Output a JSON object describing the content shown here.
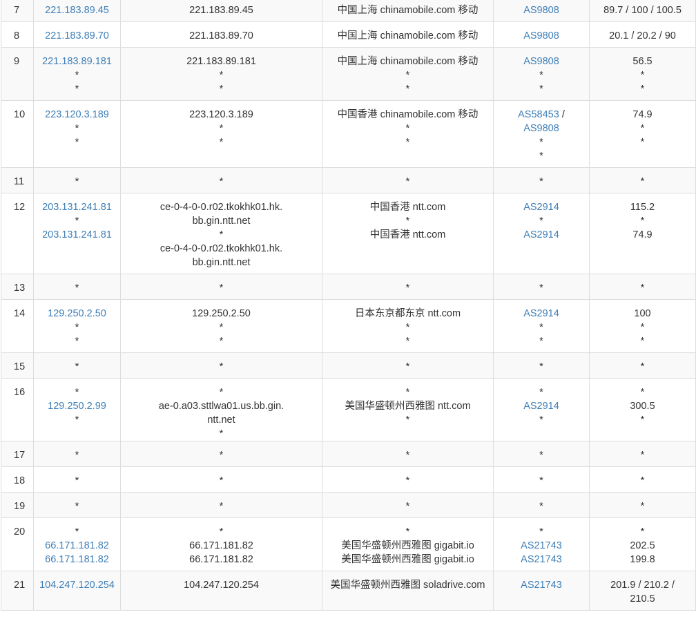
{
  "rows": [
    {
      "hop": "7",
      "h": 37,
      "ips": [
        {
          "t": "221.183.89.45",
          "link": true
        }
      ],
      "hosts": [
        "221.183.89.45"
      ],
      "locs": [
        "中国上海 chinamobile.com 移动"
      ],
      "as_lines": [
        [
          {
            "t": "AS9808",
            "link": true
          }
        ]
      ],
      "lat": [
        "89.7 / 100 / 100.5"
      ]
    },
    {
      "hop": "8",
      "h": 37,
      "ips": [
        {
          "t": "221.183.89.70",
          "link": true
        }
      ],
      "hosts": [
        "221.183.89.70"
      ],
      "locs": [
        "中国上海 chinamobile.com 移动"
      ],
      "as_lines": [
        [
          {
            "t": "AS9808",
            "link": true
          }
        ]
      ],
      "lat": [
        "20.1 / 20.2 / 90"
      ]
    },
    {
      "hop": "9",
      "h": 77,
      "ips": [
        {
          "t": "221.183.89.181",
          "link": true
        },
        {
          "t": "*"
        },
        {
          "t": "*"
        }
      ],
      "hosts": [
        "221.183.89.181",
        "*",
        "*"
      ],
      "locs": [
        "中国上海 chinamobile.com 移动",
        "*",
        "*"
      ],
      "as_lines": [
        [
          {
            "t": "AS9808",
            "link": true
          }
        ],
        [
          {
            "t": "*"
          }
        ],
        [
          {
            "t": "*"
          }
        ]
      ],
      "lat": [
        "56.5",
        "*",
        "*"
      ]
    },
    {
      "hop": "10",
      "h": 97,
      "ips": [
        {
          "t": "223.120.3.189",
          "link": true
        },
        {
          "t": "*"
        },
        {
          "t": "*"
        }
      ],
      "hosts": [
        "223.120.3.189",
        "*",
        "*"
      ],
      "locs": [
        "中国香港 chinamobile.com 移动",
        "*",
        "*"
      ],
      "as_lines": [
        [
          {
            "t": "AS58453",
            "link": true
          },
          {
            "t": " / "
          }
        ],
        [
          {
            "t": "AS9808",
            "link": true
          }
        ],
        [
          {
            "t": "*"
          }
        ],
        [
          {
            "t": "*"
          }
        ]
      ],
      "lat": [
        "74.9",
        "*",
        "*"
      ]
    },
    {
      "hop": "11",
      "h": 37,
      "ips": [
        {
          "t": "*"
        }
      ],
      "hosts": [
        "*"
      ],
      "locs": [
        "*"
      ],
      "as_lines": [
        [
          {
            "t": "*"
          }
        ]
      ],
      "lat": [
        "*"
      ]
    },
    {
      "hop": "12",
      "h": 117,
      "ips": [
        {
          "t": "203.131.241.81",
          "link": true
        },
        {
          "t": "*"
        },
        {
          "t": "203.131.241.81",
          "link": true
        }
      ],
      "hosts": [
        "ce-0-4-0-0.r02.tkokhk01.hk.bb.gin.ntt.net",
        "*",
        "ce-0-4-0-0.r02.tkokhk01.hk.bb.gin.ntt.net"
      ],
      "locs": [
        "中国香港 ntt.com",
        "*",
        "中国香港 ntt.com"
      ],
      "as_lines": [
        [
          {
            "t": "AS2914",
            "link": true
          }
        ],
        [
          {
            "t": "*"
          }
        ],
        [
          {
            "t": "AS2914",
            "link": true
          }
        ]
      ],
      "lat": [
        "115.2",
        "*",
        "74.9"
      ]
    },
    {
      "hop": "13",
      "h": 37,
      "ips": [
        {
          "t": "*"
        }
      ],
      "hosts": [
        "*"
      ],
      "locs": [
        "*"
      ],
      "as_lines": [
        [
          {
            "t": "*"
          }
        ]
      ],
      "lat": [
        "*"
      ]
    },
    {
      "hop": "14",
      "h": 77,
      "ips": [
        {
          "t": "129.250.2.50",
          "link": true
        },
        {
          "t": "*"
        },
        {
          "t": "*"
        }
      ],
      "hosts": [
        "129.250.2.50",
        "*",
        "*"
      ],
      "locs": [
        "日本东京都东京 ntt.com",
        "*",
        "*"
      ],
      "as_lines": [
        [
          {
            "t": "AS2914",
            "link": true
          }
        ],
        [
          {
            "t": "*"
          }
        ],
        [
          {
            "t": "*"
          }
        ]
      ],
      "lat": [
        "100",
        "*",
        "*"
      ]
    },
    {
      "hop": "15",
      "h": 37,
      "ips": [
        {
          "t": "*"
        }
      ],
      "hosts": [
        "*"
      ],
      "locs": [
        "*"
      ],
      "as_lines": [
        [
          {
            "t": "*"
          }
        ]
      ],
      "lat": [
        "*"
      ]
    },
    {
      "hop": "16",
      "h": 77,
      "ips": [
        {
          "t": "*"
        },
        {
          "t": "129.250.2.99",
          "link": true
        },
        {
          "t": "*"
        }
      ],
      "hosts": [
        "*",
        "ae-0.a03.sttlwa01.us.bb.gin.ntt.net",
        "*"
      ],
      "locs": [
        "*",
        "美国华盛顿州西雅图 ntt.com",
        "*"
      ],
      "as_lines": [
        [
          {
            "t": "*"
          }
        ],
        [
          {
            "t": "AS2914",
            "link": true
          }
        ],
        [
          {
            "t": "*"
          }
        ]
      ],
      "lat": [
        "*",
        "300.5",
        "*"
      ]
    },
    {
      "hop": "17",
      "h": 37,
      "ips": [
        {
          "t": "*"
        }
      ],
      "hosts": [
        "*"
      ],
      "locs": [
        "*"
      ],
      "as_lines": [
        [
          {
            "t": "*"
          }
        ]
      ],
      "lat": [
        "*"
      ]
    },
    {
      "hop": "18",
      "h": 37,
      "ips": [
        {
          "t": "*"
        }
      ],
      "hosts": [
        "*"
      ],
      "locs": [
        "*"
      ],
      "as_lines": [
        [
          {
            "t": "*"
          }
        ]
      ],
      "lat": [
        "*"
      ]
    },
    {
      "hop": "19",
      "h": 37,
      "ips": [
        {
          "t": "*"
        }
      ],
      "hosts": [
        "*"
      ],
      "locs": [
        "*"
      ],
      "as_lines": [
        [
          {
            "t": "*"
          }
        ]
      ],
      "lat": [
        "*"
      ]
    },
    {
      "hop": "20",
      "h": 77,
      "ips": [
        {
          "t": "*"
        },
        {
          "t": "66.171.181.82",
          "link": true
        },
        {
          "t": "66.171.181.82",
          "link": true
        }
      ],
      "hosts": [
        "*",
        "66.171.181.82",
        "66.171.181.82"
      ],
      "locs": [
        "*",
        "美国华盛顿州西雅图 gigabit.io",
        "美国华盛顿州西雅图 gigabit.io"
      ],
      "as_lines": [
        [
          {
            "t": "*"
          }
        ],
        [
          {
            "t": "AS21743",
            "link": true
          }
        ],
        [
          {
            "t": "AS21743",
            "link": true
          }
        ]
      ],
      "lat": [
        "*",
        "202.5",
        "199.8"
      ]
    },
    {
      "hop": "21",
      "h": 57,
      "ips": [
        {
          "t": "104.247.120.254",
          "link": true
        }
      ],
      "hosts": [
        "104.247.120.254"
      ],
      "locs": [
        "美国华盛顿州西雅图 soladrive.com"
      ],
      "as_lines": [
        [
          {
            "t": "AS21743",
            "link": true
          }
        ]
      ],
      "lat": [
        "201.9 / 210.2 /",
        "210.5"
      ]
    }
  ]
}
